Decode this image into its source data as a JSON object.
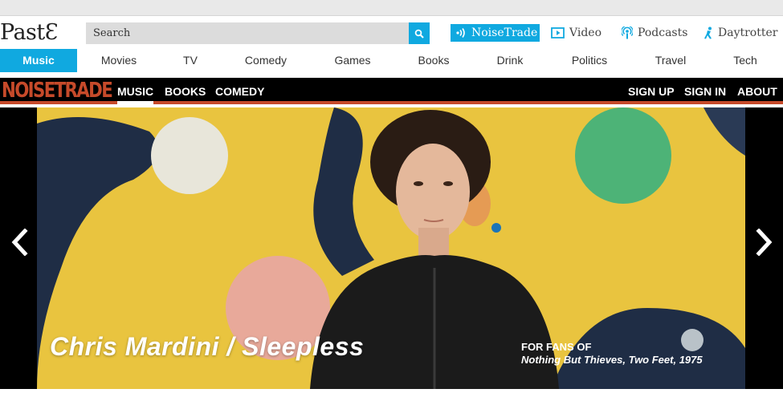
{
  "header": {
    "logo": "PastƐ",
    "search_placeholder": "Search",
    "utility_links": [
      {
        "label": "NoiseTrade",
        "icon": "noisetrade-icon"
      },
      {
        "label": "Video",
        "icon": "video-icon"
      },
      {
        "label": "Podcasts",
        "icon": "podcast-icon"
      },
      {
        "label": "Daytrotter",
        "icon": "daytrotter-icon"
      }
    ]
  },
  "nav": {
    "items": [
      "Music",
      "Movies",
      "TV",
      "Comedy",
      "Games",
      "Books",
      "Drink",
      "Politics",
      "Travel",
      "Tech"
    ],
    "active": "Music"
  },
  "noisetrade": {
    "logo": "NOISETRADE",
    "left_links": [
      "MUSIC",
      "BOOKS",
      "COMEDY"
    ],
    "right_links": [
      "SIGN UP",
      "SIGN IN",
      "ABOUT"
    ]
  },
  "hero": {
    "title": "Chris Mardini / Sleepless",
    "fans_label": "FOR FANS OF",
    "fans_value": "Nothing But Thieves, Two Feet, 1975",
    "prev_icon": "chevron-left-icon",
    "next_icon": "chevron-right-icon"
  },
  "colors": {
    "accent": "#10a9e0",
    "noisetrade": "#c64a2a",
    "wall": "#e8c43d"
  }
}
